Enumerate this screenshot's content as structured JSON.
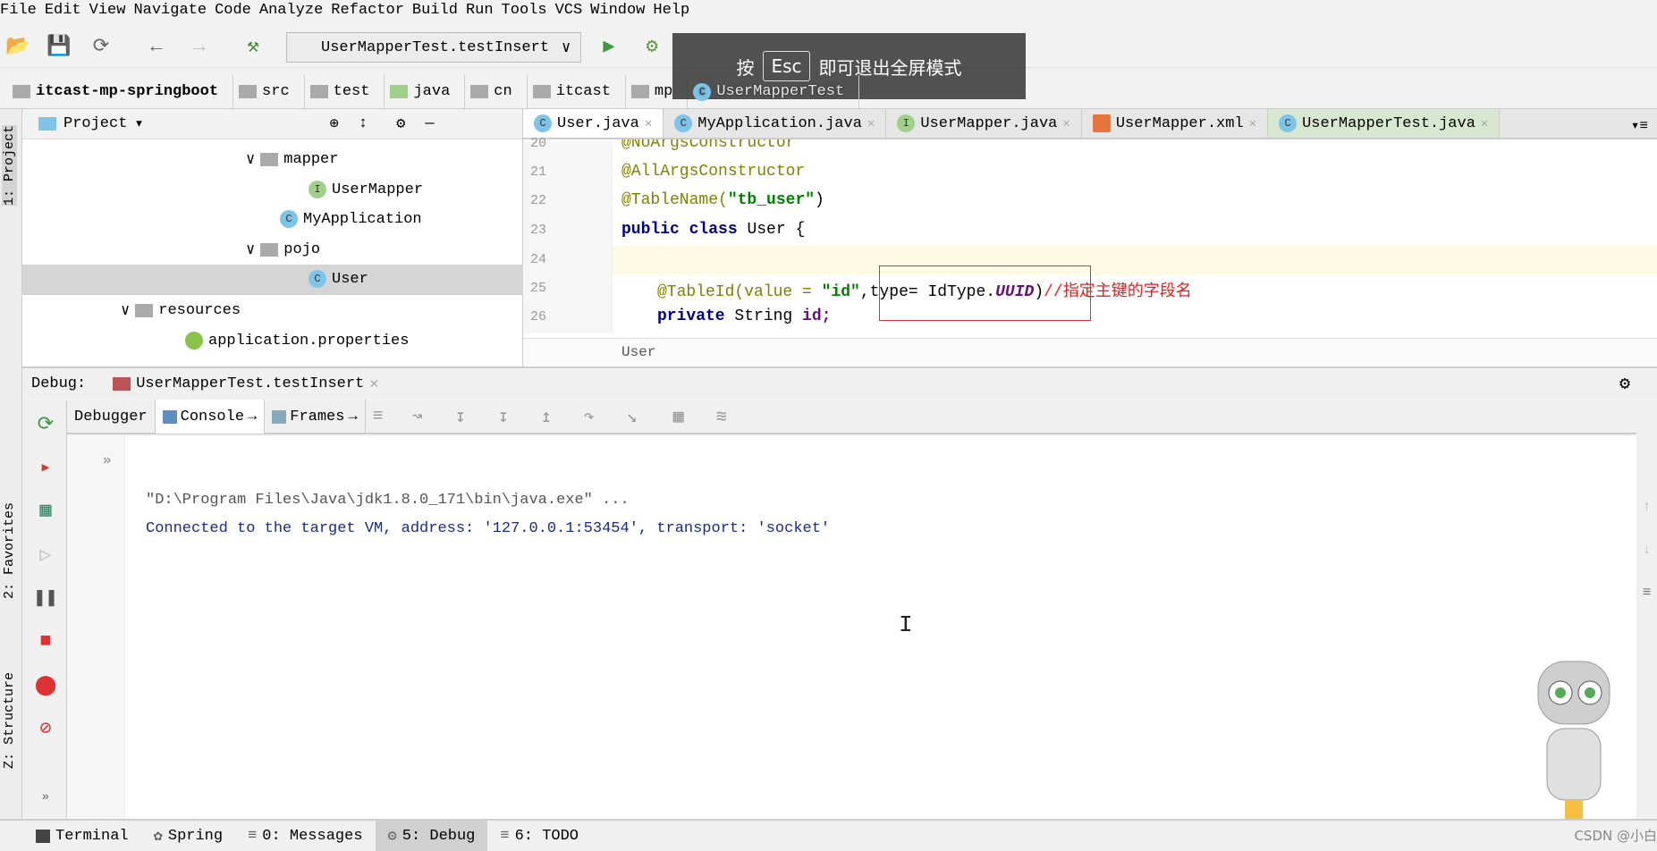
{
  "menu": [
    "File",
    "Edit",
    "View",
    "Navigate",
    "Code",
    "Analyze",
    "Refactor",
    "Build",
    "Run",
    "Tools",
    "VCS",
    "Window",
    "Help"
  ],
  "toolbar": {
    "run_config": "UserMapperTest.testInsert"
  },
  "overlay": {
    "prefix": "按",
    "key": "Esc",
    "suffix": "即可退出全屏模式"
  },
  "breadcrumb": [
    "itcast-mp-springboot",
    "src",
    "test",
    "java",
    "cn",
    "itcast",
    "mp",
    "UserMapperTest"
  ],
  "left_stripe": {
    "project": "1: Project",
    "favorites": "2: Favorites",
    "structure": "Z: Structure"
  },
  "project": {
    "title": "Project",
    "tree": [
      {
        "label": "mapper",
        "type": "folder"
      },
      {
        "label": "UserMapper",
        "type": "interface"
      },
      {
        "label": "MyApplication",
        "type": "class"
      },
      {
        "label": "pojo",
        "type": "folder"
      },
      {
        "label": "User",
        "type": "class",
        "selected": true
      },
      {
        "label": "resources",
        "type": "folder"
      },
      {
        "label": "application.properties",
        "type": "properties"
      }
    ]
  },
  "editor": {
    "tabs": [
      {
        "label": "User.java",
        "active": true
      },
      {
        "label": "MyApplication.java"
      },
      {
        "label": "UserMapper.java"
      },
      {
        "label": "UserMapper.xml"
      },
      {
        "label": "UserMapperTest.java"
      }
    ],
    "line_numbers": [
      "20",
      "21",
      "22",
      "23",
      "24",
      "25",
      "26"
    ],
    "lines": {
      "l20": "@NoArgsConstructor",
      "l21": "@AllArgsConstructor",
      "l22a": "@TableName(",
      "l22b": "\"tb_user\"",
      "l22c": ")",
      "l23a": "public class ",
      "l23b": "User {",
      "l25a": "@TableId(value = ",
      "l25b": "\"id\"",
      "l25c": ",type= IdType.",
      "l25d": "UUID",
      "l25e": ")",
      "l25f": "//指定主键的字段名",
      "l26a": "private ",
      "l26b": "String ",
      "l26c": "id;"
    },
    "breadcrumb": "User"
  },
  "debug": {
    "label": "Debug:",
    "session": "UserMapperTest.testInsert",
    "tabs": [
      "Debugger",
      "Console",
      "Frames"
    ],
    "console": [
      "\"D:\\Program Files\\Java\\jdk1.8.0_171\\bin\\java.exe\" ...",
      "Connected to the target VM, address: '127.0.0.1:53454', transport: 'socket'"
    ]
  },
  "bottom": [
    "Terminal",
    "Spring",
    "0: Messages",
    "5: Debug",
    "6: TODO"
  ],
  "watermark": "CSDN @小白",
  "colors": {
    "keyword": "#000080",
    "annotation": "#808000",
    "string": "#008000",
    "comment": "#e02020",
    "highlight_box": "#e03030"
  }
}
